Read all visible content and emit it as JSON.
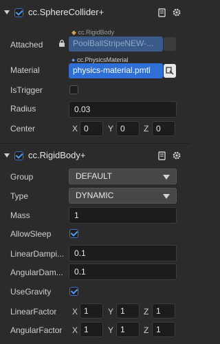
{
  "sphere": {
    "title": "cc.SphereCollider+",
    "enabled": true,
    "attached": {
      "label": "Attached",
      "type_label": "cc.RigidBody",
      "value": "PoolBallStripeNEW-..."
    },
    "material": {
      "label": "Material",
      "type_label": "cc.PhysicsMaterial",
      "value": "physics-material.pmtl"
    },
    "is_trigger": {
      "label": "IsTrigger",
      "checked": false
    },
    "radius": {
      "label": "Radius",
      "value": "0.03"
    },
    "center": {
      "label": "Center",
      "x_axis": "X",
      "y_axis": "Y",
      "z_axis": "Z",
      "x": "0",
      "y": "0",
      "z": "0"
    }
  },
  "rigid": {
    "title": "cc.RigidBody+",
    "enabled": true,
    "group": {
      "label": "Group",
      "value": "DEFAULT"
    },
    "type": {
      "label": "Type",
      "value": "DYNAMIC"
    },
    "mass": {
      "label": "Mass",
      "value": "1"
    },
    "allow_sleep": {
      "label": "AllowSleep",
      "checked": true
    },
    "linear_damping": {
      "label": "LinearDampi...",
      "value": "0.1"
    },
    "angular_damping": {
      "label": "AngularDam...",
      "value": "0.1"
    },
    "use_gravity": {
      "label": "UseGravity",
      "checked": true
    },
    "linear_factor": {
      "label": "LinearFactor",
      "x_axis": "X",
      "y_axis": "Y",
      "z_axis": "Z",
      "x": "1",
      "y": "1",
      "z": "1"
    },
    "angular_factor": {
      "label": "AngularFactor",
      "x_axis": "X",
      "y_axis": "Y",
      "z_axis": "Z",
      "x": "1",
      "y": "1",
      "z": "1"
    }
  },
  "colors": {
    "panel_bg": "#2b2b2b",
    "field_bg": "#1c1c1c",
    "accent_blue": "#2f6fd6",
    "check_blue": "#4a9df8"
  },
  "icons": [
    "chevron-down-icon",
    "checkbox-icon",
    "doc-icon",
    "gear-icon",
    "lock-icon",
    "picker-icon",
    "dropdown-arrow-icon"
  ]
}
